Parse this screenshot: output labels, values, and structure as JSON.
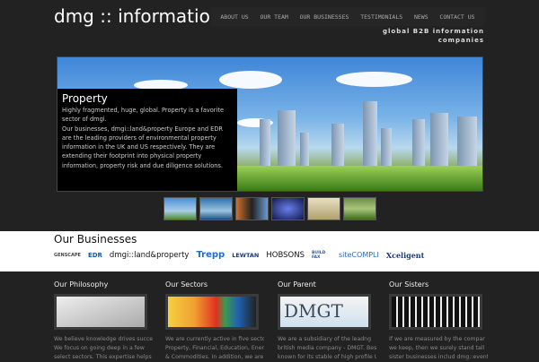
{
  "header": {
    "logo": "dmg :: information",
    "tagline": "global B2B information companies",
    "nav": [
      "ABOUT US",
      "OUR TEAM",
      "OUR BUSINESSES",
      "TESTIMONIALS",
      "NEWS",
      "CONTACT US"
    ]
  },
  "hero": {
    "title": "Property",
    "body": "Highly fragmented, huge, global. Property is a favorite sector of dmgi.",
    "body2": "Our businesses, dmgi::land&property Europe and EDR are the leading providers of environmental property information in the UK and US respectively. They are extending their footprint into physical property information, property risk and due diligence solutions."
  },
  "businesses": {
    "title": "Our Businesses",
    "logos": [
      "GENSCAPE",
      "EDR",
      "dmgi::land&property",
      "Trepp",
      "LEWTAN",
      "HOBSONS",
      "BUILD FAX",
      "siteCOMPLI",
      "Xceligent"
    ]
  },
  "columns": [
    {
      "title": "Our Philosophy",
      "lines": [
        "We believe knowledge drives success.",
        "We focus on going deep in a few",
        "select sectors. This expertise helps us"
      ]
    },
    {
      "title": "Our Sectors",
      "lines": [
        "We are currently active in five sectors:",
        "Property, Financial, Education, Energy",
        "& Commodities. In addition, we are"
      ]
    },
    {
      "title": "Our Parent",
      "image_text": "DMGT",
      "lines": [
        "We are a subsidiary of the leadng",
        "british media company - DMGT. Best",
        "known for its stable of high profile UK"
      ]
    },
    {
      "title": "Our Sisters",
      "lines": [
        "If we are measured by the compar",
        "we keep, then we surely stand tall",
        "sister businesses includ dmg::event"
      ]
    }
  ]
}
